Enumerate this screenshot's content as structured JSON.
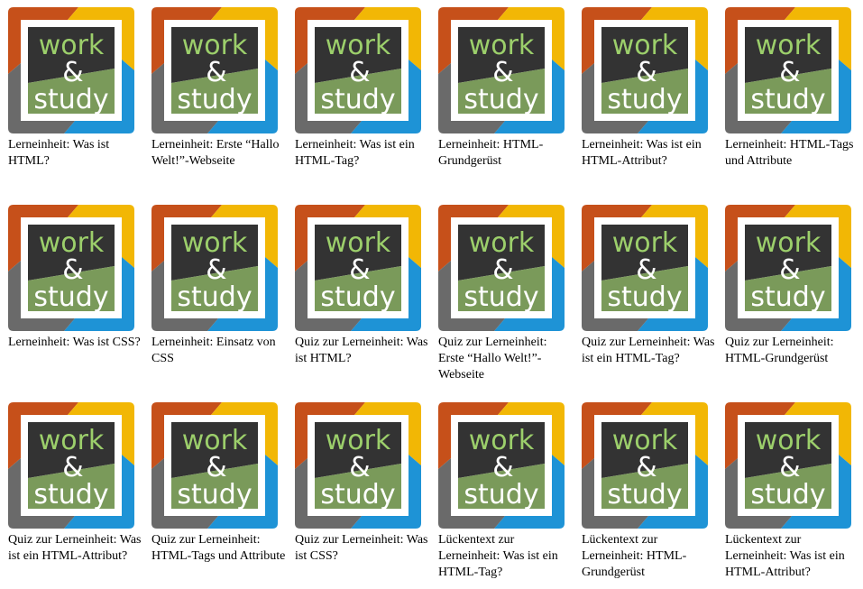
{
  "logo": {
    "text_work": "work",
    "text_amp": "&",
    "text_study": "study",
    "colors": {
      "orange": "#c6501a",
      "yellow": "#f2b705",
      "blue": "#1e93d6",
      "gray": "#6a6a6a",
      "dark": "#333333",
      "green": "#7a9a5a",
      "text": "#ffffff",
      "green_text": "#9ccf6b"
    }
  },
  "items": [
    {
      "title": "Lerneinheit: Was ist HTML?"
    },
    {
      "title": "Lerneinheit: Erste “Hallo Welt!”-Webseite"
    },
    {
      "title": "Lerneinheit: Was ist ein HTML-Tag?"
    },
    {
      "title": "Lerneinheit: HTML-Grundgerüst"
    },
    {
      "title": "Lerneinheit: Was ist ein HTML-Attribut?"
    },
    {
      "title": "Lerneinheit: HTML-Tags und Attribute"
    },
    {
      "title": "Lerneinheit: Was ist CSS?"
    },
    {
      "title": "Lerneinheit: Einsatz von CSS"
    },
    {
      "title": "Quiz zur Lerneinheit: Was ist HTML?"
    },
    {
      "title": "Quiz zur Lerneinheit: Erste “Hallo Welt!”-Webseite"
    },
    {
      "title": "Quiz zur Lerneinheit: Was ist ein HTML-Tag?"
    },
    {
      "title": "Quiz zur Lerneinheit: HTML-Grundgerüst"
    },
    {
      "title": "Quiz zur Lerneinheit: Was ist ein HTML-Attribut?"
    },
    {
      "title": "Quiz zur Lerneinheit: HTML-Tags und Attribute"
    },
    {
      "title": "Quiz zur Lerneinheit: Was ist CSS?"
    },
    {
      "title": "Lückentext zur Lerneinheit: Was ist ein HTML-Tag?"
    },
    {
      "title": "Lückentext zur Lerneinheit: HTML-Grundgerüst"
    },
    {
      "title": "Lückentext zur Lerneinheit: Was ist ein HTML-Attribut?"
    }
  ]
}
